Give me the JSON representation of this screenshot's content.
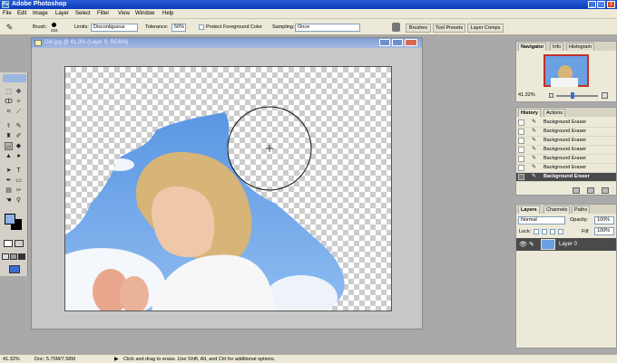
{
  "titlebar": {
    "title": "Adobe Photoshop",
    "logo": "Ps",
    "minimize": "_",
    "maximize": "□",
    "close": "x"
  },
  "menu": [
    "File",
    "Edit",
    "Image",
    "Layer",
    "Select",
    "Filter",
    "View",
    "Window",
    "Help"
  ],
  "options": {
    "brush_label": "Brush:",
    "brush_size": "416",
    "limits_label": "Limits:",
    "limits_value": "Discontiguous",
    "tolerance_label": "Tolerance:",
    "tolerance_value": "50%",
    "protect_label": "Protect Foreground Color",
    "sampling_label": "Sampling:",
    "sampling_value": "Once",
    "tabs": [
      "Brushes",
      "Tool Presets",
      "Layer Comps"
    ]
  },
  "document": {
    "title": "Girl.jpg @ 41.3% (Layer 0, RGB/8)"
  },
  "navigator": {
    "tabs": [
      "Navigator",
      "Info",
      "Histogram"
    ],
    "zoom": "41.32%"
  },
  "history": {
    "tabs": [
      "History",
      "Actions"
    ],
    "items": [
      "Background Eraser",
      "Background Eraser",
      "Background Eraser",
      "Background Eraser",
      "Background Eraser",
      "Background Eraser",
      "Background Eraser"
    ]
  },
  "layers": {
    "tabs": [
      "Layers",
      "Channels",
      "Paths"
    ],
    "blend_mode": "Normal",
    "opacity_label": "Opacity:",
    "opacity_value": "100%",
    "lock_label": "Lock:",
    "fill_label": "Fill:",
    "fill_value": "100%",
    "layer_name": "Layer 0"
  },
  "status": {
    "zoom": "41.32%",
    "doc": "Doc: 5.75M/7.58M",
    "hint": "Click and drag to erase. Use Shift, Alt, and Ctrl for additional options."
  },
  "colors": {
    "title_blue": "#1a4fd0",
    "sky": "#5b9be0",
    "selected_row": "#4a4a4a",
    "fg_color": "#8fb0e8",
    "bg_color": "#000000"
  }
}
